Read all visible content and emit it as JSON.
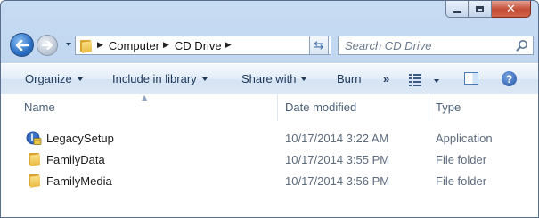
{
  "address_bar": {
    "breadcrumbs": [
      "Computer",
      "CD Drive"
    ]
  },
  "search": {
    "placeholder": "Search CD Drive"
  },
  "command_bar": {
    "organize": "Organize",
    "include_in_library": "Include in library",
    "share_with": "Share with",
    "burn": "Burn",
    "more": "»"
  },
  "columns": {
    "name": "Name",
    "date_modified": "Date modified",
    "type": "Type"
  },
  "files": [
    {
      "name": "LegacySetup",
      "date": "10/17/2014 3:22 AM",
      "type": "Application",
      "icon": "setup-app-icon"
    },
    {
      "name": "FamilyData",
      "date": "10/17/2014 3:55 PM",
      "type": "File folder",
      "icon": "folder-icon"
    },
    {
      "name": "FamilyMedia",
      "date": "10/17/2014 3:56 PM",
      "type": "File folder",
      "icon": "folder-icon"
    }
  ],
  "colors": {
    "chrome": "#b9cfea",
    "command_text": "#1e395b",
    "header_text": "#4c607a",
    "detail_text": "#5d6b7e"
  }
}
